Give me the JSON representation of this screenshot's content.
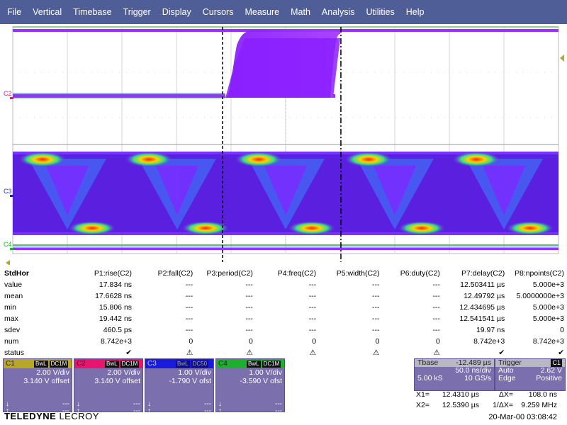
{
  "menu": [
    "File",
    "Vertical",
    "Timebase",
    "Trigger",
    "Display",
    "Cursors",
    "Measure",
    "Math",
    "Analysis",
    "Utilities",
    "Help"
  ],
  "trace_labels": {
    "c2": "C2",
    "c3": "C3",
    "c4": "C4"
  },
  "trace_colors": {
    "c2": "#9b30ff",
    "c3": "#6a23e8",
    "c4": "#22aa33",
    "grid": "#cfcfcf",
    "menubar": "#4f5e97",
    "panel": "#7b6fae"
  },
  "measurements": {
    "corner_label": "StdHor",
    "headers": [
      "P1:rise(C2)",
      "P2:fall(C2)",
      "P3:period(C2)",
      "P4:freq(C2)",
      "P5:width(C2)",
      "P6:duty(C2)",
      "P7:delay(C2)",
      "P8:npoints(C2)"
    ],
    "rows": [
      {
        "label": "value",
        "cells": [
          "17.834 ns",
          "---",
          "---",
          "---",
          "---",
          "---",
          "12.503411 µs",
          "5.000e+3"
        ]
      },
      {
        "label": "mean",
        "cells": [
          "17.6628 ns",
          "---",
          "---",
          "---",
          "---",
          "---",
          "12.49792 µs",
          "5.0000000e+3"
        ]
      },
      {
        "label": "min",
        "cells": [
          "15.806 ns",
          "---",
          "---",
          "---",
          "---",
          "---",
          "12.434695 µs",
          "5.000e+3"
        ]
      },
      {
        "label": "max",
        "cells": [
          "19.442 ns",
          "---",
          "---",
          "---",
          "---",
          "---",
          "12.541541 µs",
          "5.000e+3"
        ]
      },
      {
        "label": "sdev",
        "cells": [
          "460.5 ps",
          "---",
          "---",
          "---",
          "---",
          "---",
          "19.97 ns",
          "0"
        ]
      },
      {
        "label": "num",
        "cells": [
          "8.742e+3",
          "0",
          "0",
          "0",
          "0",
          "0",
          "8.742e+3",
          "8.742e+3"
        ]
      },
      {
        "label": "status",
        "cells": [
          "✔",
          "⚠",
          "⚠",
          "⚠",
          "⚠",
          "⚠",
          "✔",
          "✔"
        ]
      }
    ]
  },
  "channels": [
    {
      "name": "C1",
      "tags": [
        "BwL",
        "DC1M"
      ],
      "vdiv": "2.00 V/div",
      "offset": "3.140 V offset",
      "header_color": "#b7a629",
      "dn": "↓",
      "up": "↑",
      "dash": "---"
    },
    {
      "name": "C2",
      "tags": [
        "BwL",
        "DC1M"
      ],
      "vdiv": "2.00 V/div",
      "offset": "3.140 V offset",
      "header_color": "#e8156f",
      "dn": "↓",
      "up": "↑",
      "dash": "---"
    },
    {
      "name": "C3",
      "tags": [
        "BwL",
        "DC50"
      ],
      "vdiv": "1.00 V/div",
      "offset": "-1.790 V ofst",
      "header_color": "#1b1bdd",
      "dn": "↓",
      "up": "↑",
      "dash": "---"
    },
    {
      "name": "C4",
      "tags": [
        "BwL",
        "DC1M"
      ],
      "vdiv": "1.00 V/div",
      "offset": "-3.590 V ofst",
      "header_color": "#1fae30",
      "dn": "↓",
      "up": "↑",
      "dash": "---"
    }
  ],
  "timebase": {
    "label": "Tbase",
    "delay": "-12.489 µs",
    "tdiv": "50.0 ns/div",
    "samples": "5.00 kS",
    "rate": "10 GS/s"
  },
  "trigger": {
    "label": "Trigger",
    "source": "C1",
    "mode": "Auto",
    "level": "2.62 V",
    "type": "Edge",
    "slope": "Positive"
  },
  "cursors": {
    "x1_label": "X1=",
    "x1": "12.4310 µs",
    "dx_label": "ΔX=",
    "dx": "108.0 ns",
    "x2_label": "X2=",
    "x2": "12.5390 µs",
    "inv_label": "1/ΔX=",
    "inv": "9.259 MHz"
  },
  "brand": {
    "bold": "TELEDYNE",
    "thin": " LECROY"
  },
  "datetime": "20-Mar-00 03:08:42"
}
